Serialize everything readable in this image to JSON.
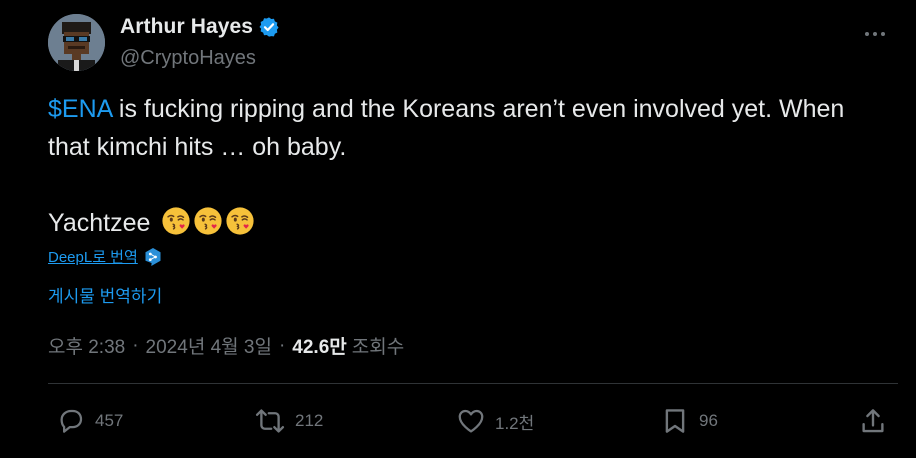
{
  "author": {
    "display_name": "Arthur Hayes",
    "handle": "@CryptoHayes",
    "verified": true
  },
  "tweet": {
    "cashtag": "$ENA",
    "line1_rest": " is fucking ripping and the Koreans aren’t even involved yet. When",
    "line2": "that kimchi hits … oh baby.",
    "line3": "Yachtzee",
    "emoji": [
      "kissing-face-icon",
      "kissing-face-icon",
      "kissing-face-icon"
    ]
  },
  "translation": {
    "deepl_label": "DeepL로 번역",
    "translate_post_label": "게시물 번역하기"
  },
  "meta": {
    "time": "오후 2:38",
    "separator": "·",
    "date": "2024년 4월 3일",
    "views_count": "42.6만",
    "views_label": "조회수"
  },
  "actions": {
    "replies": "457",
    "reposts": "212",
    "likes": "1.2천",
    "bookmarks": "96"
  },
  "colors": {
    "background": "#000000",
    "text": "#e7e9ea",
    "secondary": "#71767b",
    "accent": "#1d9bf0"
  }
}
